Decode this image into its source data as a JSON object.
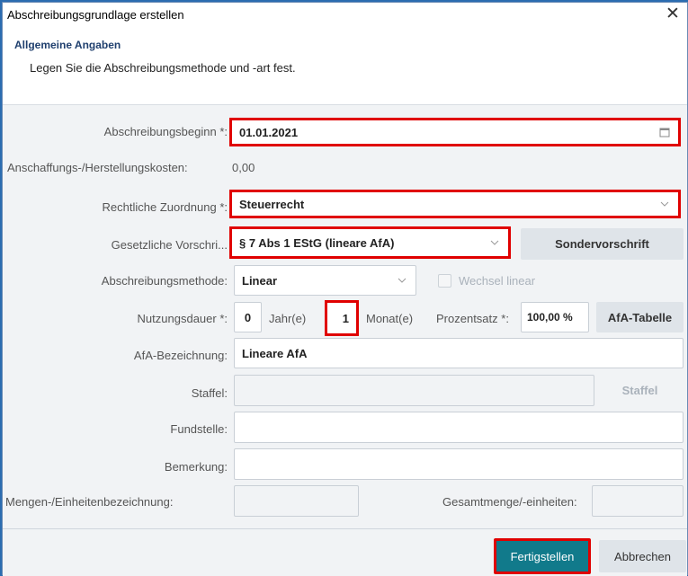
{
  "dialog": {
    "title": "Abschreibungsgrundlage erstellen",
    "close_glyph": "✕",
    "section_title": "Allgemeine Angaben",
    "section_subtitle": "Legen Sie die Abschreibungsmethode und -art fest."
  },
  "form": {
    "abschreibungsbeginn": {
      "label": "Abschreibungsbeginn *:",
      "value": "01.01.2021"
    },
    "anschaffungskosten": {
      "label": "Anschaffungs-/Herstellungskosten:",
      "value": "0,00"
    },
    "rechtliche_zuordnung": {
      "label": "Rechtliche Zuordnung *:",
      "value": "Steuerrecht"
    },
    "gesetzliche_vorschrift": {
      "label": "Gesetzliche Vorschri...",
      "value": "§ 7 Abs 1 EStG (lineare AfA)",
      "button": "Sondervorschrift"
    },
    "abschreibungsmethode": {
      "label": "Abschreibungsmethode:",
      "value": "Linear",
      "checkbox_label": "Wechsel linear"
    },
    "nutzungsdauer": {
      "label": "Nutzungsdauer *:",
      "jahre_value": "0",
      "jahre_unit": "Jahr(e)",
      "monate_value": "1",
      "monate_unit": "Monat(e)",
      "prozentsatz_label": "Prozentsatz *:",
      "prozentsatz_value": "100,00 %",
      "button": "AfA-Tabelle"
    },
    "afa_bezeichnung": {
      "label": "AfA-Bezeichnung:",
      "value": "Lineare AfA"
    },
    "staffel": {
      "label": "Staffel:",
      "value": "",
      "button": "Staffel"
    },
    "fundstelle": {
      "label": "Fundstelle:",
      "value": ""
    },
    "bemerkung": {
      "label": "Bemerkung:",
      "value": ""
    },
    "mengen": {
      "label": "Mengen-/Einheitenbezeichnung:",
      "value": ""
    },
    "gesamtmenge": {
      "label": "Gesamtmenge/-einheiten:",
      "value": ""
    }
  },
  "footer": {
    "finish_label": "Fertigstellen",
    "cancel_label": "Abbrechen"
  },
  "colors": {
    "highlight": "#e00000",
    "primary": "#117a8b",
    "heading": "#1f3f6e"
  }
}
